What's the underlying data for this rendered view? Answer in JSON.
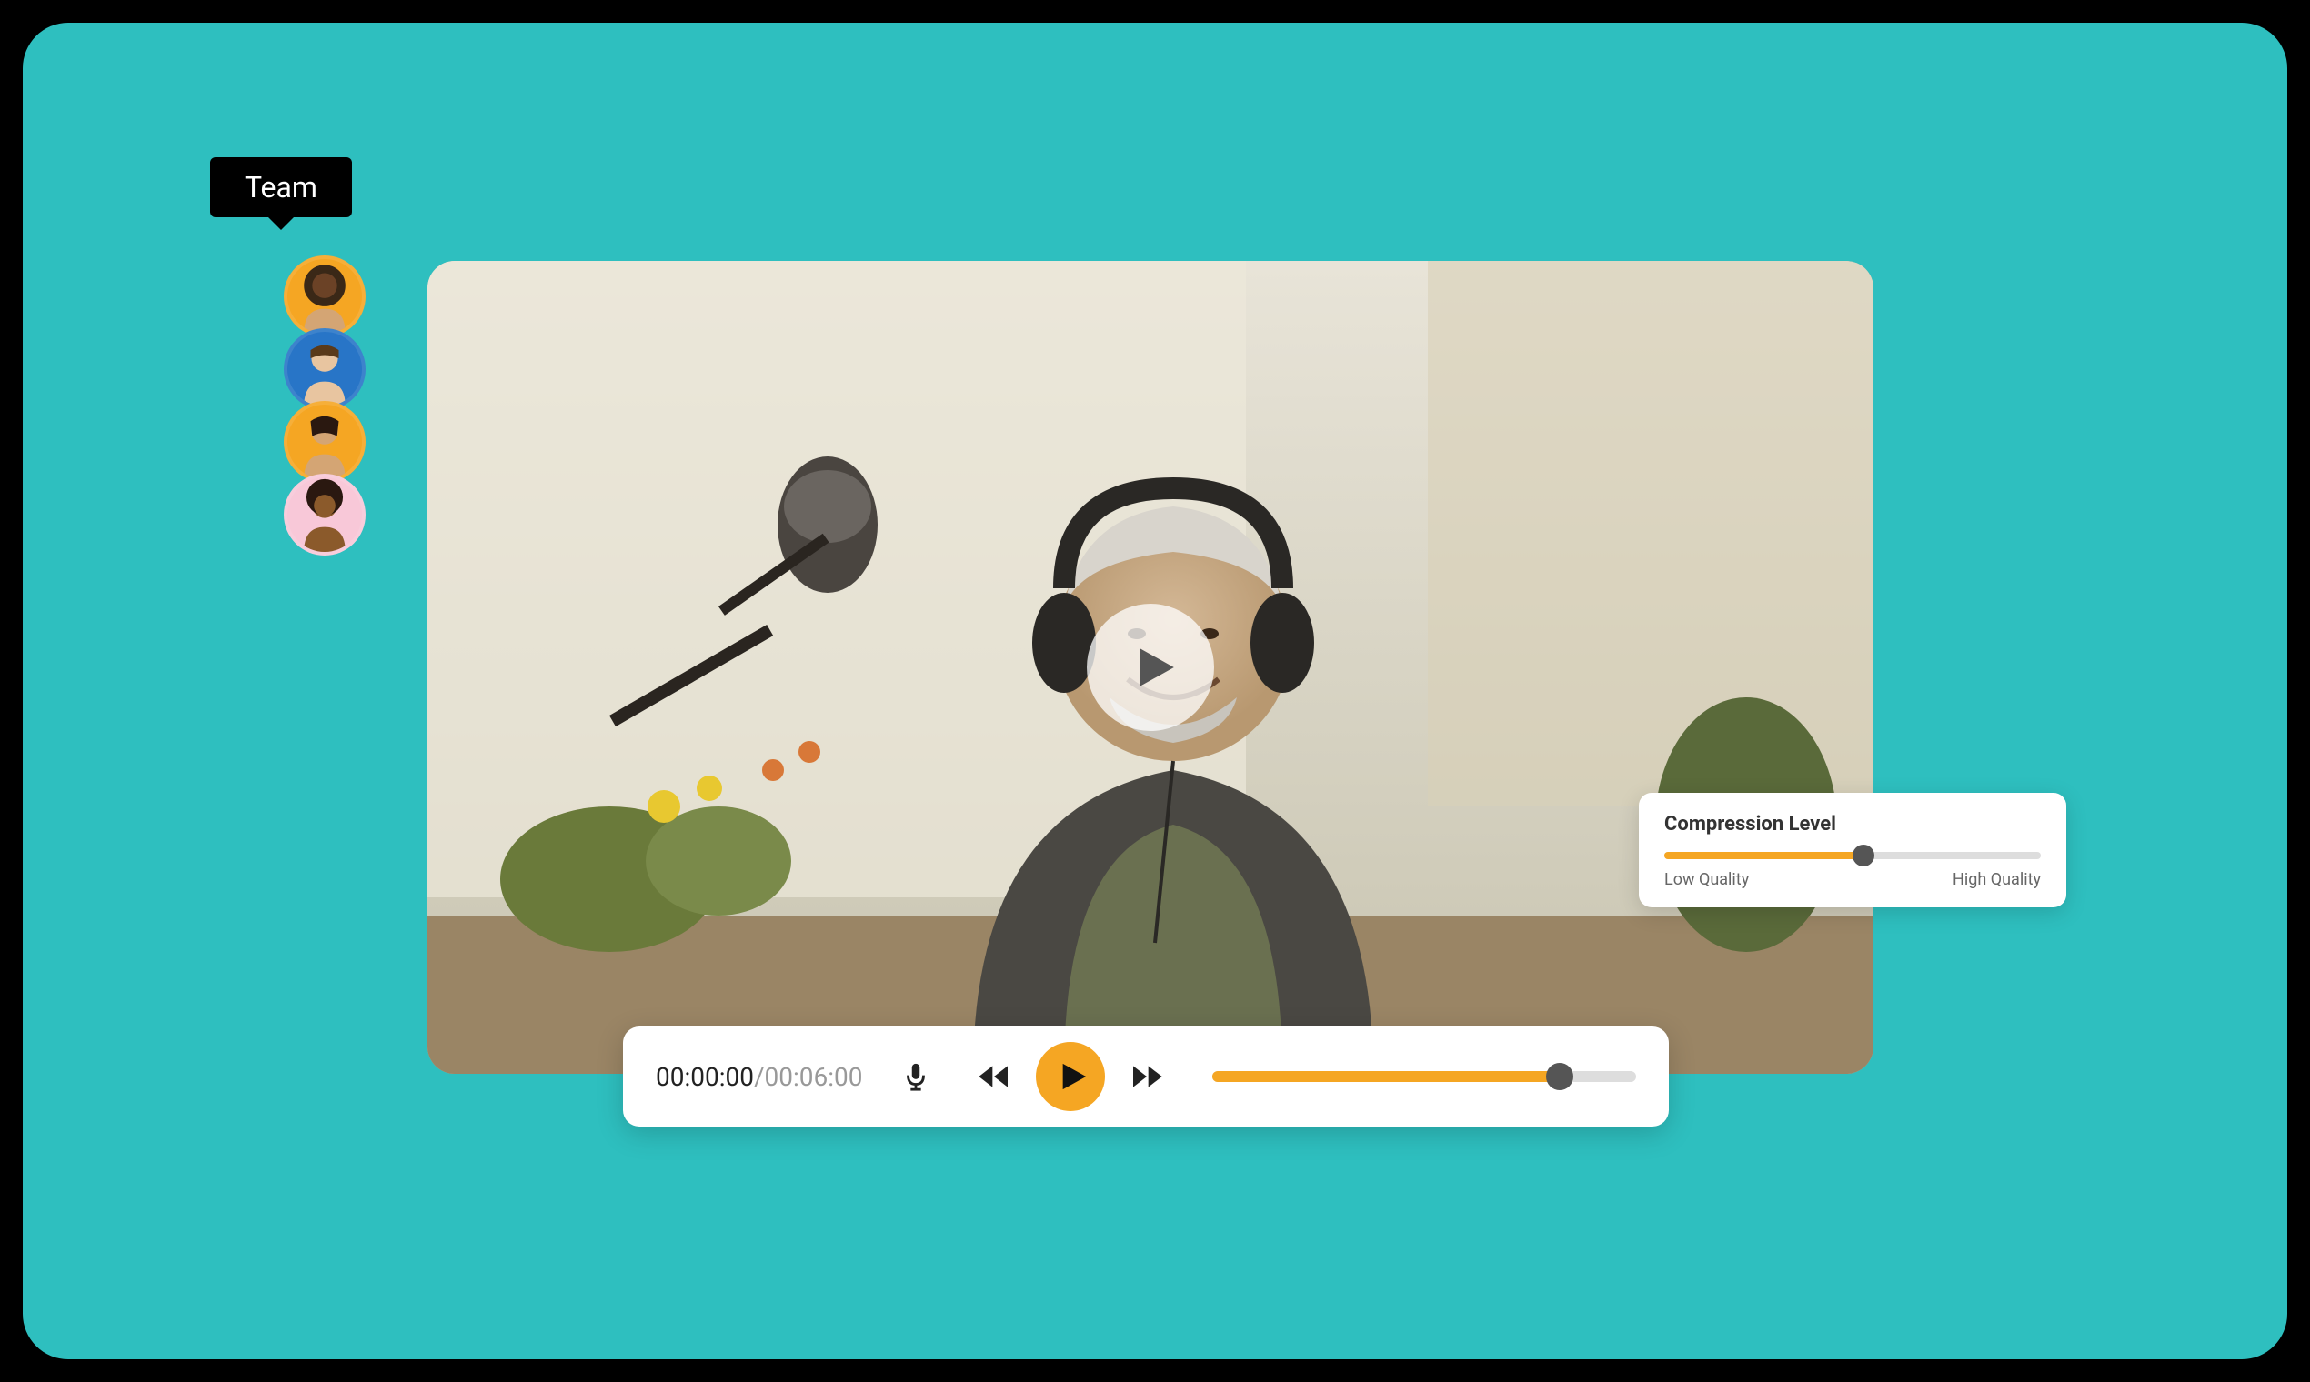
{
  "team": {
    "tooltip_label": "Team",
    "avatars": [
      {
        "bg": "#F5A623"
      },
      {
        "bg": "#2875C7"
      },
      {
        "bg": "#F5A623"
      },
      {
        "bg": "#F8C8D8"
      }
    ]
  },
  "video": {
    "overlay_icon": "play-icon"
  },
  "compression": {
    "title": "Compression Level",
    "low_label": "Low Quality",
    "high_label": "High Quality",
    "value_percent": 53
  },
  "player": {
    "time_current": "00:00:00",
    "time_separator": "/",
    "time_total": "00:06:00",
    "progress_percent": 82
  },
  "colors": {
    "accent": "#F5A623",
    "bg": "#2EBFBF"
  }
}
